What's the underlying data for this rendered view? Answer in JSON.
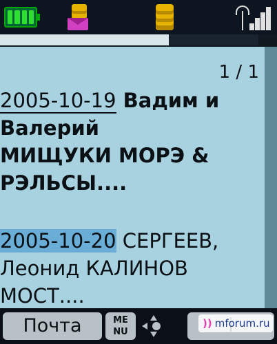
{
  "status_bar": {
    "battery_level": 1.0,
    "signal_bars": 4
  },
  "content": {
    "page_indicator": "1 / 1",
    "messages": [
      {
        "date": "2005-10-19",
        "line1": " Вадим и",
        "line2": "Валерий",
        "line3": "МИЩУКИ МОРЭ &",
        "line4": "РЭЛЬСЫ...."
      },
      {
        "date": "2005-10-20",
        "line1": " СЕРГЕЕВ,",
        "line2": "Леонид КАЛИНОВ",
        "line3": "МОСТ...."
      }
    ]
  },
  "softkeys": {
    "left_label": "Почта",
    "menu_label_top": "ME",
    "menu_label_bottom": "NU",
    "right_label": "i"
  },
  "watermark": {
    "text": "mforum.ru"
  }
}
